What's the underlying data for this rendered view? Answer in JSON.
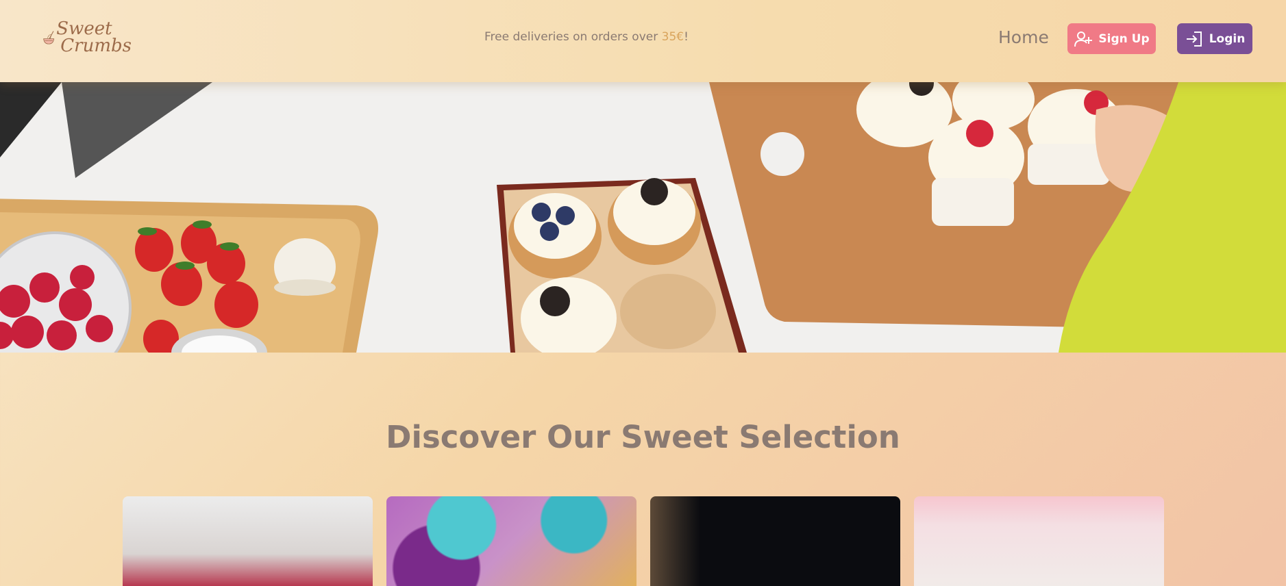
{
  "brand": {
    "line1": "Sweet",
    "line2": "Crumbs"
  },
  "promo": {
    "prefix": "Free deliveries on orders over ",
    "amount": "35€",
    "suffix": "!"
  },
  "nav": {
    "home_label": "Home",
    "signup_label": "Sign Up",
    "login_label": "Login"
  },
  "colors": {
    "signup": "#f07a86",
    "login": "#7a4f96",
    "text": "#8a7a72",
    "accent": "#d9a45c"
  },
  "section": {
    "title": "Discover Our Sweet Selection"
  },
  "icons": {
    "logo": "whisk-bowl-icon",
    "signup": "user-plus-icon",
    "login": "login-arrow-icon"
  }
}
